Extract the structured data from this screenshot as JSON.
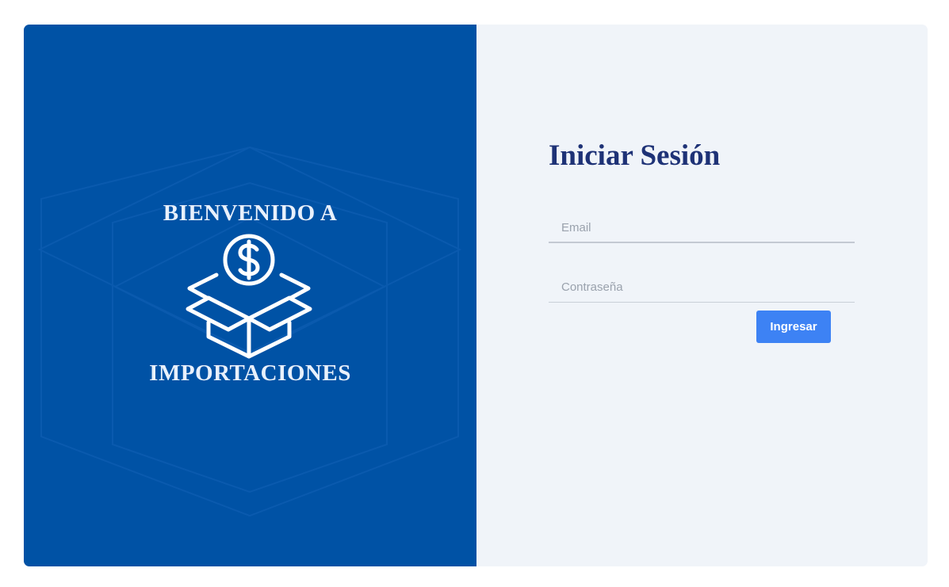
{
  "welcome": {
    "line1": "BIENVENIDO A",
    "line2": "IMPORTACIONES"
  },
  "login": {
    "title": "Iniciar Sesión",
    "email_placeholder": "Email",
    "password_placeholder": "Contraseña",
    "submit_label": "Ingresar"
  },
  "colors": {
    "left_panel": "#0052a5",
    "right_panel": "#f0f4f9",
    "title": "#1e3276",
    "button": "#3d82f4"
  },
  "icons": {
    "hero": "money-box-icon"
  }
}
